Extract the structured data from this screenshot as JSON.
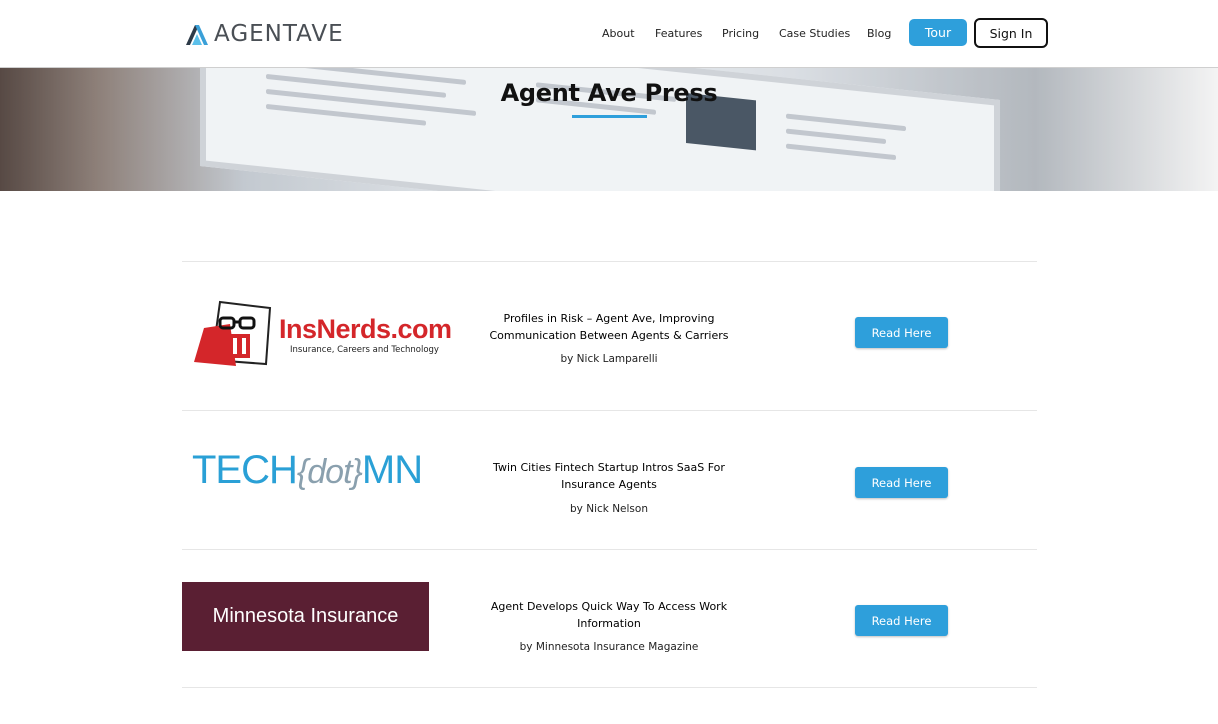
{
  "header": {
    "logo_text": "AGENTAVE",
    "nav": [
      "About",
      "Features",
      "Pricing",
      "Case Studies",
      "Blog"
    ],
    "tour_label": "Tour",
    "signin_label": "Sign In"
  },
  "hero": {
    "title": "Agent Ave Press"
  },
  "press": [
    {
      "logo": {
        "text": "InsNerds.com",
        "subtitle": "Insurance, Careers and Technology"
      },
      "title": "Profiles in Risk – Agent Ave, Improving Communication Between Agents & Carriers",
      "author": "by Nick Lamparelli",
      "button": "Read Here"
    },
    {
      "logo": {
        "prefix": "TECH",
        "middle": "{dot}",
        "suffix": "MN"
      },
      "title": "Twin Cities Fintech Startup Intros SaaS For Insurance Agents",
      "author": "by Nick Nelson",
      "button": "Read Here"
    },
    {
      "logo": {
        "text": "Minnesota Insurance"
      },
      "title": "Agent Develops Quick Way To Access Work Information",
      "author": "by Minnesota Insurance Magazine",
      "button": "Read Here"
    }
  ],
  "colors": {
    "accent": "#2e9fdb",
    "insnerds_red": "#d4262a",
    "techmn_blue": "#2aa0d6",
    "mn_insurance_bg": "#5a1f33"
  }
}
